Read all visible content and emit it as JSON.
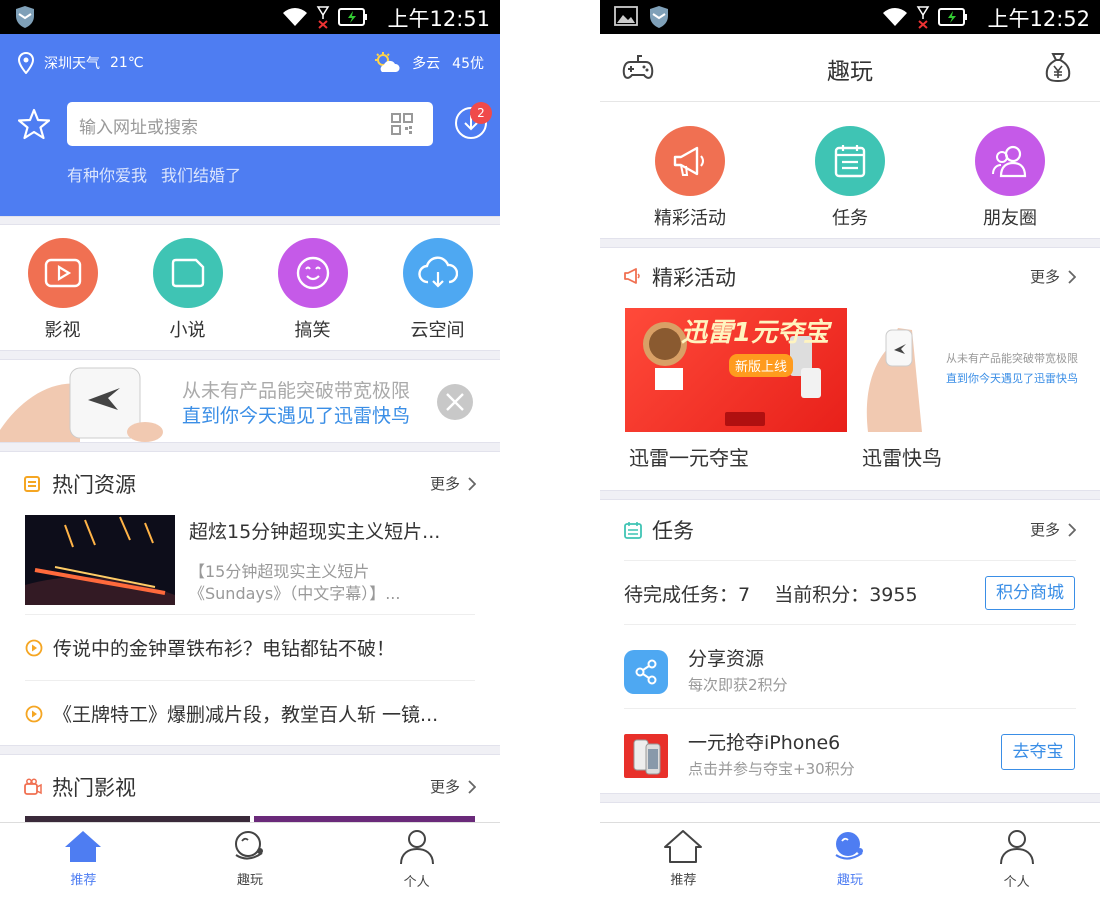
{
  "left": {
    "status": {
      "time": "上午12:51"
    },
    "header": {
      "city_weather": "深圳天气",
      "temperature": "21℃",
      "condition": "多云",
      "aqi": "45优",
      "search_placeholder": "输入网址或搜索",
      "download_badge": "2",
      "hot_words": [
        "有种你爱我",
        "我们结婚了"
      ]
    },
    "categories": [
      {
        "label": "影视",
        "color": "#f07052"
      },
      {
        "label": "小说",
        "color": "#3fc4b4"
      },
      {
        "label": "搞笑",
        "color": "#c55ae8"
      },
      {
        "label": "云空间",
        "color": "#4ea8f2"
      }
    ],
    "banner": {
      "line1": "从未有产品能突破带宽极限",
      "line2": "直到你今天遇见了迅雷快鸟"
    },
    "hot_resources": {
      "title": "热门资源",
      "more": "更多",
      "featured": {
        "title": "超炫15分钟超现实主义短片...",
        "desc": "【15分钟超现实主义短片《Sundays》（中文字幕）】..."
      },
      "items": [
        "传说中的金钟罩铁布衫？电钻都钻不破！",
        "《王牌特工》爆删减片段，教堂百人斩 一镜..."
      ]
    },
    "hot_videos": {
      "title": "热门影视",
      "more": "更多"
    },
    "tabs": [
      {
        "label": "推荐",
        "active": true
      },
      {
        "label": "趣玩",
        "active": false
      },
      {
        "label": "个人",
        "active": false
      }
    ]
  },
  "right": {
    "status": {
      "time": "上午12:52"
    },
    "header": {
      "title": "趣玩"
    },
    "features": [
      {
        "label": "精彩活动",
        "color": "#f07052"
      },
      {
        "label": "任务",
        "color": "#3fc4b4"
      },
      {
        "label": "朋友圈",
        "color": "#c55ae8"
      }
    ],
    "activities": {
      "title": "精彩活动",
      "more": "更多",
      "items": [
        {
          "label": "迅雷一元夺宝",
          "banner_text": "迅雷1元夺宝",
          "sub_text": "新版上线"
        },
        {
          "label": "迅雷快鸟",
          "line1": "从未有产品能突破带宽极限",
          "line2": "直到你今天遇见了迅雷快鸟"
        }
      ]
    },
    "tasks": {
      "title": "任务",
      "more": "更多",
      "pending_label": "待完成任务：7",
      "points_label": "当前积分：3955",
      "shop_button": "积分商城",
      "items": [
        {
          "name": "分享资源",
          "sub": "每次即获2积分",
          "button": ""
        },
        {
          "name": "一元抢夺iPhone6",
          "sub": "点击并参与夺宝+30积分",
          "button": "去夺宝"
        }
      ]
    },
    "tabs": [
      {
        "label": "推荐",
        "active": false
      },
      {
        "label": "趣玩",
        "active": true
      },
      {
        "label": "个人",
        "active": false
      }
    ]
  }
}
